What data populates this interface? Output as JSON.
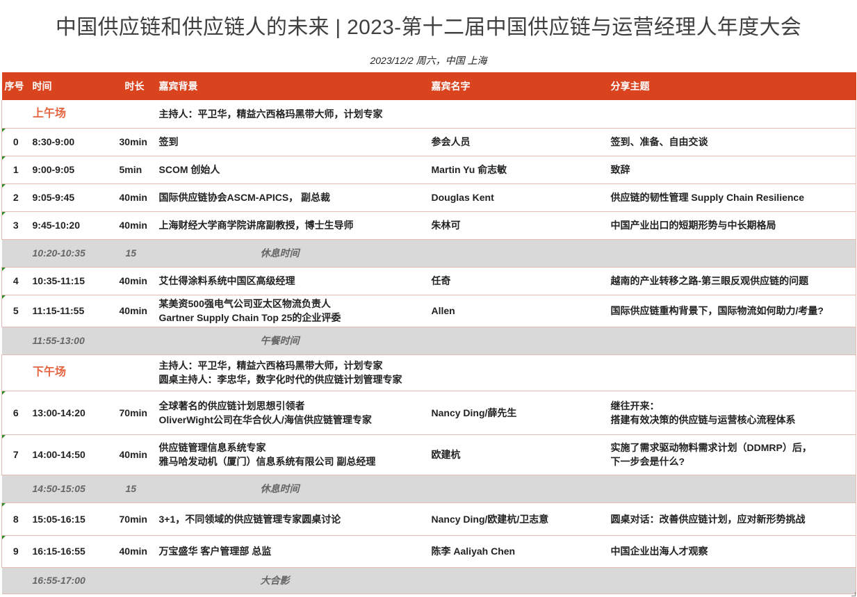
{
  "title": "中国供应链和供应链人的未来 | 2023-第十二届中国供应链与运营经理人年度大会",
  "subtitle": "2023/12/2 周六，中国 上海",
  "columns": {
    "no": "序号",
    "time": "时间",
    "dur": "时长",
    "bg": "嘉宾背景",
    "name": "嘉宾名字",
    "topic": "分享主题"
  },
  "morning": {
    "label": "上午场",
    "host": "主持人：平卫华，精益六西格玛黑带大师，计划专家"
  },
  "afternoon": {
    "label": "下午场",
    "host_line1": "主持人：平卫华，精益六西格玛黑带大师，计划专家",
    "host_line2": "圆桌主持人：李忠华，数字化时代的供应链计划管理专家"
  },
  "rows": [
    {
      "no": "0",
      "time": "8:30-9:00",
      "dur": "30min",
      "bg1": "签到",
      "bg2": "",
      "name": "参会人员",
      "topic1": "签到、准备、自由交谈",
      "topic2": ""
    },
    {
      "no": "1",
      "time": "9:00-9:05",
      "dur": "5min",
      "bg1": "SCOM 创始人",
      "bg2": "",
      "name": "Martin Yu 俞志敏",
      "topic1": "致辞",
      "topic2": ""
    },
    {
      "no": "2",
      "time": "9:05-9:45",
      "dur": "40min",
      "bg1": "国际供应链协会ASCM-APICS， 副总裁",
      "bg2": "",
      "name": "Douglas Kent",
      "topic1": "供应链的韧性管理 Supply Chain Resilience",
      "topic2": ""
    },
    {
      "no": "3",
      "time": "9:45-10:20",
      "dur": "40min",
      "bg1": "上海财经大学商学院讲席副教授，博士生导师",
      "bg2": "",
      "name": "朱林可",
      "topic1": "中国产业出口的短期形势与中长期格局",
      "topic2": ""
    },
    {
      "no": "4",
      "time": "10:35-11:15",
      "dur": "40min",
      "bg1": "艾仕得涂料系统中国区高级经理",
      "bg2": "",
      "name": "任奇",
      "topic1": "越南的产业转移之路-第三眼反观供应链的问题",
      "topic2": ""
    },
    {
      "no": "5",
      "time": "11:15-11:55",
      "dur": "40min",
      "bg1": "某美资500强电气公司亚太区物流负责人",
      "bg2": "Gartner Supply Chain Top 25的企业评委",
      "name": "Allen",
      "topic1": "国际供应链重构背景下，国际物流如何助力/考量?",
      "topic2": ""
    },
    {
      "no": "6",
      "time": "13:00-14:20",
      "dur": "70min",
      "bg1": "全球著名的供应链计划思想引领者",
      "bg2": "OliverWight公司在华合伙人/海信供应链管理专家",
      "name": "Nancy Ding/薛先生",
      "topic1": "继往开来：",
      "topic2": "搭建有效决策的供应链与运营核心流程体系"
    },
    {
      "no": "7",
      "time": "14:00-14:50",
      "dur": "40min",
      "bg1": "供应链管理信息系统专家",
      "bg2": "雅马哈发动机（厦门）信息系统有限公司  副总经理",
      "name": "欧建杭",
      "topic1": "实施了需求驱动物料需求计划（DDMRP）后，",
      "topic2": "下一步会是什么?"
    },
    {
      "no": "8",
      "time": "15:05-16:15",
      "dur": "70min",
      "bg1": "3+1，不同领域的供应链管理专家圆桌讨论",
      "bg2": "",
      "name": "Nancy Ding/欧建杭/卫志意",
      "topic1": "圆桌对话：改善供应链计划，应对新形势挑战",
      "topic2": ""
    },
    {
      "no": "9",
      "time": "16:15-16:55",
      "dur": "40min",
      "bg1": "万宝盛华  客户管理部 总监",
      "bg2": "",
      "name": "陈李  Aaliyah Chen",
      "topic1": "中国企业出海人才观察",
      "topic2": ""
    }
  ],
  "breaks": [
    {
      "time": "10:20-10:35",
      "dur": "15",
      "label": "休息时间"
    },
    {
      "time": "11:55-13:00",
      "dur": "",
      "label": "午餐时间"
    },
    {
      "time": "14:50-15:05",
      "dur": "15",
      "label": "休息时间"
    },
    {
      "time": "16:55-17:00",
      "dur": "",
      "label": "大合影"
    }
  ]
}
